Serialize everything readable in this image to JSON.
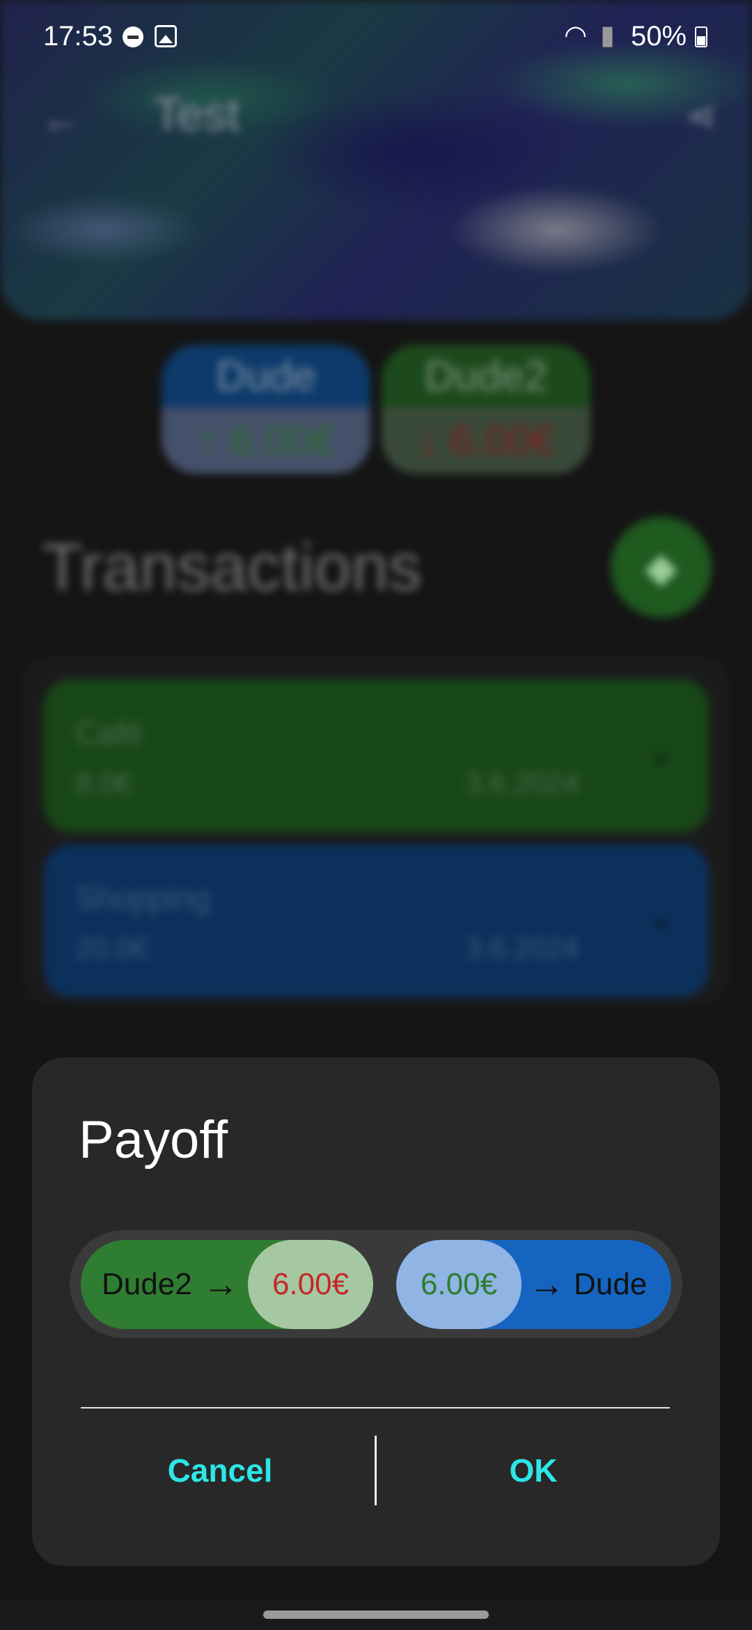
{
  "status_bar": {
    "time": "17:53",
    "battery": "50%"
  },
  "app": {
    "title": "Test",
    "balances": [
      {
        "name": "Dude",
        "amount": "6.00€",
        "direction": "up"
      },
      {
        "name": "Dude2",
        "amount": "6.00€",
        "direction": "down"
      }
    ],
    "transactions_title": "Transactions",
    "transactions": [
      {
        "name": "Café",
        "amount": "8.0€",
        "date": "3.6.2024",
        "color": "#2e7d32"
      },
      {
        "name": "Shopping",
        "amount": "20.0€",
        "date": "3.6.2024",
        "color": "#1565c0"
      }
    ]
  },
  "dialog": {
    "title": "Payoff",
    "payments": [
      {
        "from": "Dude2",
        "amount": "6.00€",
        "to": ""
      },
      {
        "from": "",
        "amount": "6.00€",
        "to": "Dude"
      }
    ],
    "cancel_label": "Cancel",
    "ok_label": "OK"
  },
  "colors": {
    "accent": "#2ee6e6",
    "green": "#2e7d32",
    "blue": "#1565c0",
    "negative": "#c62828"
  }
}
